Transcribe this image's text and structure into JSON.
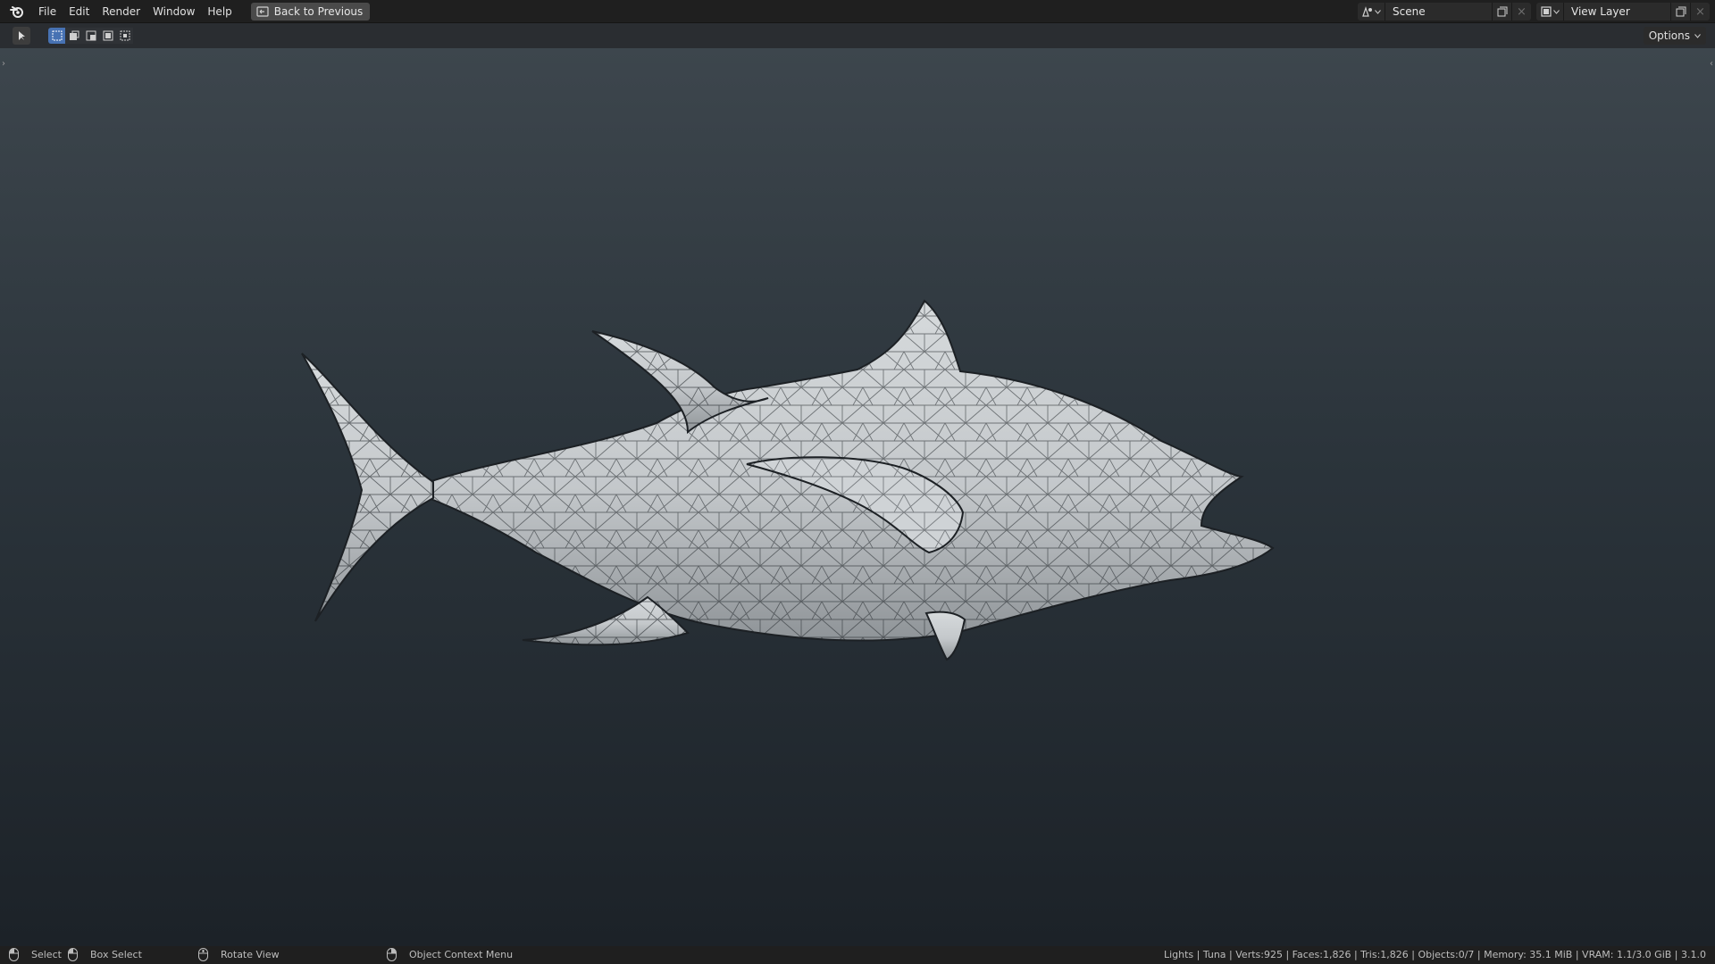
{
  "menu": {
    "file": "File",
    "edit": "Edit",
    "render": "Render",
    "window": "Window",
    "help": "Help",
    "back_to_previous": "Back to Previous"
  },
  "scene": {
    "name": "Scene"
  },
  "view_layer": {
    "name": "View Layer"
  },
  "header": {
    "options_label": "Options"
  },
  "status": {
    "select": "Select",
    "box_select": "Box Select",
    "rotate_view": "Rotate View",
    "context_menu": "Object Context Menu",
    "stats": "Lights | Tuna | Verts:925 | Faces:1,826 | Tris:1,826 | Objects:0/7 | Memory: 35.1 MiB | VRAM: 1.1/3.0 GiB | 3.1.0"
  },
  "colors": {
    "accent": "#4772b3",
    "mesh": "#c9cdd0",
    "wire": "#1b1f22"
  },
  "icons": {
    "logo": "blender-logo-icon",
    "back": "back-to-previous-icon",
    "scene": "scene-icon",
    "view_layer": "view-layer-icon",
    "copy": "duplicate-icon",
    "close": "close-icon"
  }
}
